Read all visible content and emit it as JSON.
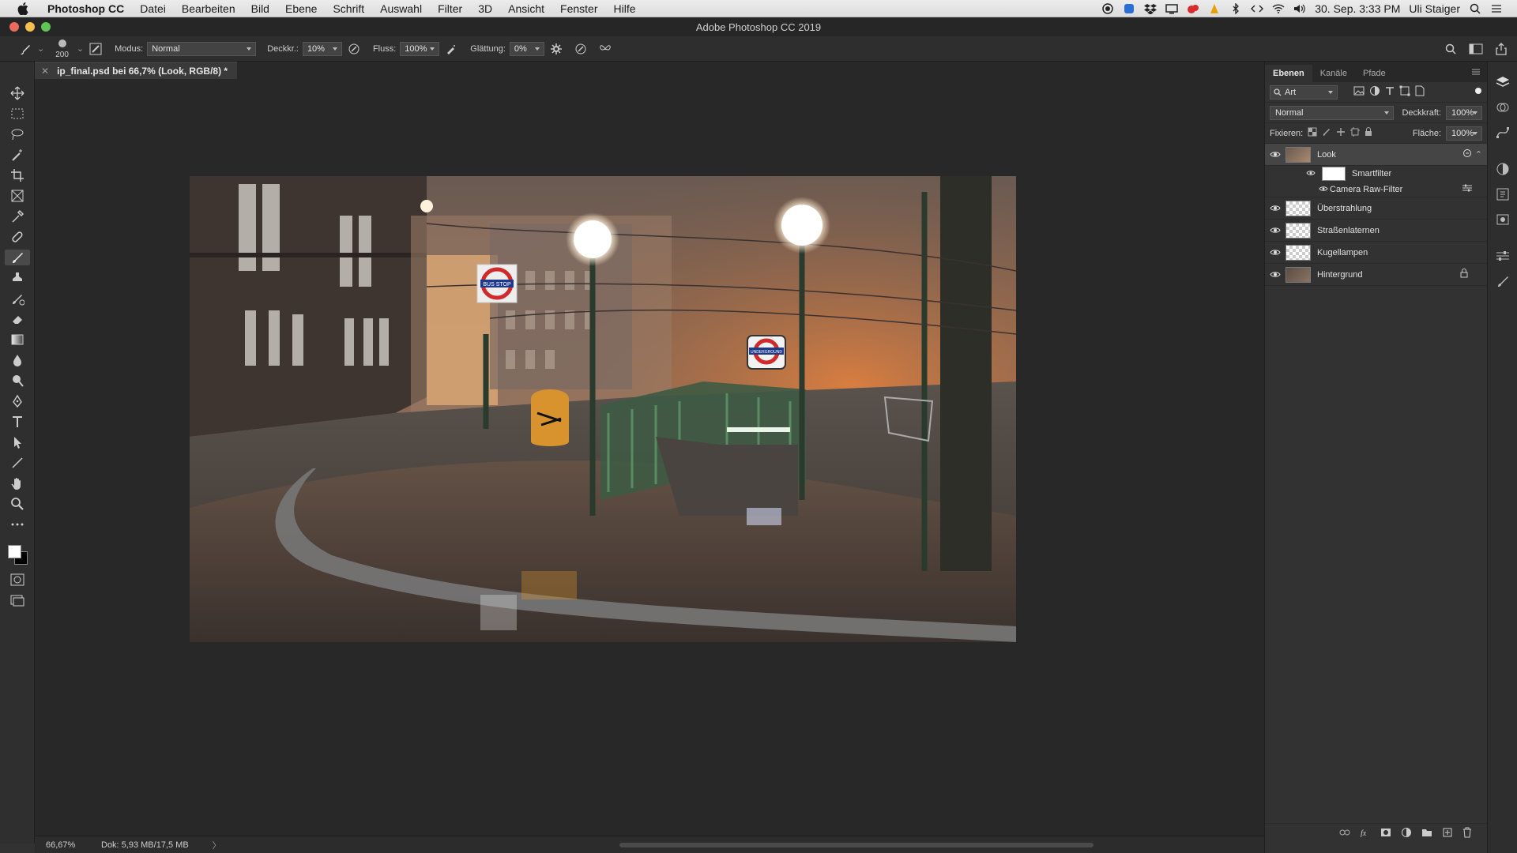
{
  "menubar": {
    "items": [
      "Photoshop CC",
      "Datei",
      "Bearbeiten",
      "Bild",
      "Ebene",
      "Schrift",
      "Auswahl",
      "Filter",
      "3D",
      "Ansicht",
      "Fenster",
      "Hilfe"
    ],
    "datetime": "30. Sep.  3:33 PM",
    "user": "Uli Staiger"
  },
  "window": {
    "title": "Adobe Photoshop CC 2019"
  },
  "options": {
    "brush_size": "200",
    "mode_label": "Modus:",
    "mode_value": "Normal",
    "opacity_label": "Deckkr.:",
    "opacity_value": "10%",
    "flow_label": "Fluss:",
    "flow_value": "100%",
    "smoothing_label": "Glättung:",
    "smoothing_value": "0%"
  },
  "document": {
    "tab_title": "ip_final.psd bei 66,7% (Look, RGB/8) *"
  },
  "status": {
    "zoom": "66,67%",
    "doc_info": "Dok: 5,93 MB/17,5 MB",
    "arrow": "〉"
  },
  "layers_panel": {
    "tabs": [
      "Ebenen",
      "Kanäle",
      "Pfade"
    ],
    "filter_kind": "Art",
    "blend_mode": "Normal",
    "opacity_label": "Deckkraft:",
    "opacity_value": "100%",
    "lock_label": "Fixieren:",
    "fill_label": "Fläche:",
    "fill_value": "100%",
    "layers": [
      {
        "name": "Look",
        "smartfilter_label": "Smartfilter",
        "filter_name": "Camera Raw-Filter"
      },
      {
        "name": "Überstrahlung"
      },
      {
        "name": "Straßenlaternen"
      },
      {
        "name": "Kugellampen"
      },
      {
        "name": "Hintergrund"
      }
    ]
  },
  "canvas": {
    "signs": {
      "bus_stop": "BUS STOP",
      "underground": "UNDERGROUND"
    }
  },
  "colors": {
    "accent_red": "#ec6a5e",
    "accent_yellow": "#f4bf4f",
    "accent_green": "#61c554"
  }
}
